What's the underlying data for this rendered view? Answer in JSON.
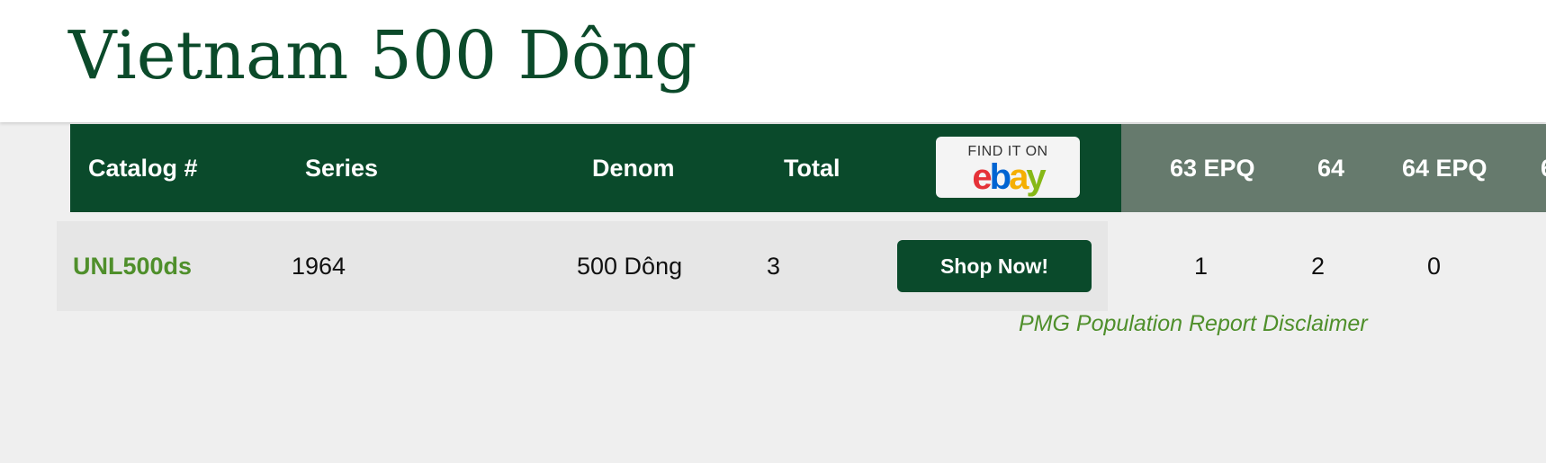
{
  "page": {
    "title": "Vietnam 500 Dông"
  },
  "table": {
    "headers": {
      "catalog": "Catalog #",
      "series": "Series",
      "denom": "Denom",
      "total": "Total",
      "ebay_badge_top": "FIND IT ON",
      "grades": [
        "63 EPQ",
        "64",
        "64 EPQ",
        "6"
      ]
    },
    "rows": [
      {
        "catalog": "UNL500ds",
        "series": "1964",
        "denom": "500 Dông",
        "total": "3",
        "shop_label": "Shop Now!",
        "grade_counts": [
          "1",
          "2",
          "0"
        ]
      }
    ]
  },
  "disclaimer": "PMG Population Report Disclaimer",
  "ebay_logo": {
    "letters": [
      "e",
      "b",
      "a",
      "y"
    ],
    "colors": [
      "#e53238",
      "#0064d2",
      "#f5af02",
      "#86b817"
    ]
  },
  "colors": {
    "header_bg": "#0a4a2b",
    "grade_header_bg": "#667a6d",
    "link_green": "#4f8f2b",
    "title_green": "#0b4a2a"
  }
}
